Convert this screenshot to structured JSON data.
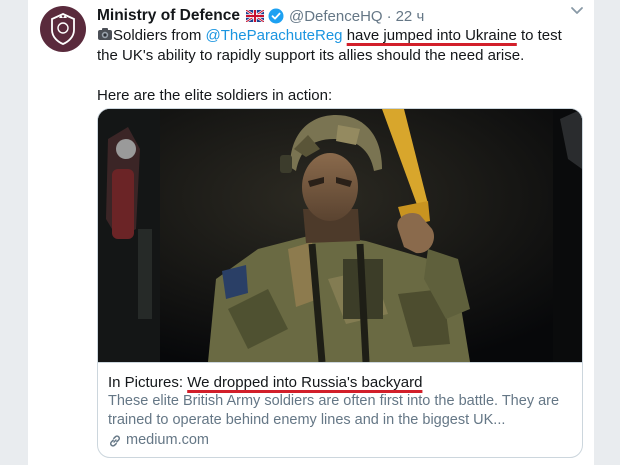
{
  "tweet": {
    "author_name": "Ministry of Defence",
    "handle": "@DefenceHQ",
    "separator": "·",
    "time": "22 ч",
    "text_line1_pre": "Soldiers from ",
    "mention": "@TheParachuteReg",
    "text_space": " ",
    "underlined_phrase": "have jumped into Ukraine",
    "text_line1_post": " to test the UK's ability to rapidly support its allies should the need arise.",
    "text_line2": "Here are the elite soldiers in action:"
  },
  "card": {
    "title_prefix": "In Pictures: ",
    "title_underlined": "We dropped into Russia's backyard",
    "description": "These elite British Army soldiers are often first into the battle. They are trained to operate behind enemy lines and in the biggest UK...",
    "domain": "medium.com"
  },
  "colors": {
    "accent": "#1b95e0",
    "underline": "#d21f2a",
    "avatar": "#5a2a3c",
    "secondary_text": "#657786"
  },
  "icons": [
    "mod-crest-icon",
    "uk-flag-icon",
    "verified-badge-icon",
    "chevron-down-icon",
    "camera-icon",
    "link-icon"
  ]
}
